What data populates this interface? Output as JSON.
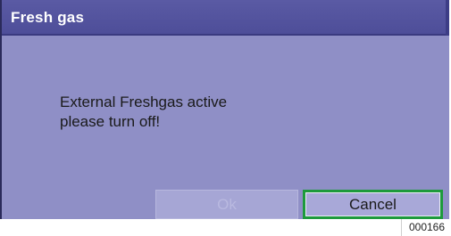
{
  "dialog": {
    "title": "Fresh gas",
    "message_line1": "External Freshgas active",
    "message_line2": "please turn off!",
    "buttons": {
      "ok": "Ok",
      "cancel": "Cancel"
    },
    "colors": {
      "title_bar": "#5252a0",
      "body": "#8f8fc6",
      "focus_border": "#1d9a3c"
    }
  },
  "figure_id": "000166"
}
